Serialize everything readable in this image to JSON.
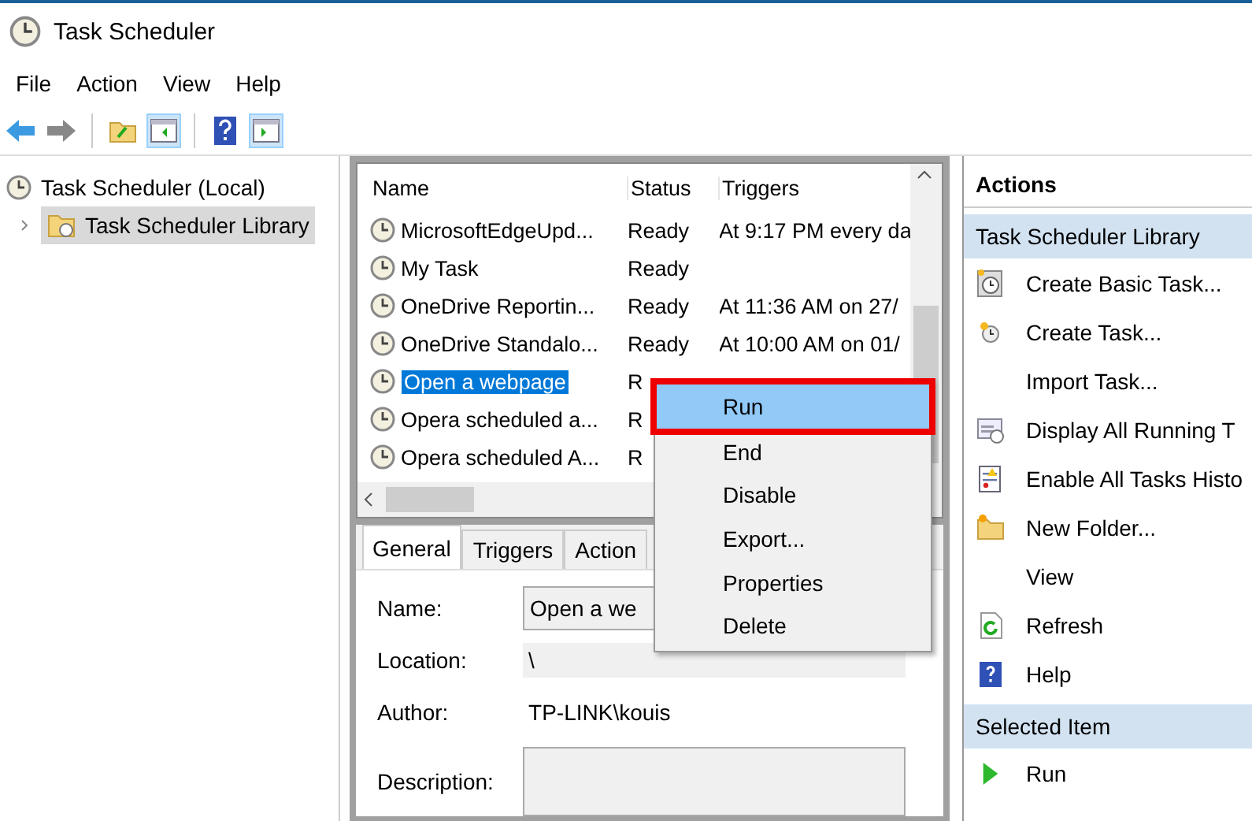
{
  "window": {
    "title": "Task Scheduler"
  },
  "menu": [
    "File",
    "Action",
    "View",
    "Help"
  ],
  "tree": [
    {
      "label": "Task Scheduler (Local)",
      "selected": false,
      "children": [
        {
          "label": "Task Scheduler Library",
          "expanded": false,
          "selected": true
        }
      ]
    }
  ],
  "task_list": {
    "columns": [
      "Name",
      "Status",
      "Triggers"
    ],
    "rows": [
      {
        "name": "MicrosoftEdgeUpd...",
        "status": "Ready",
        "triggers": "At 9:17 PM every da",
        "selected": false
      },
      {
        "name": "My Task",
        "status": "Ready",
        "triggers": "",
        "selected": false
      },
      {
        "name": "OneDrive Reportin...",
        "status": "Ready",
        "triggers": "At 11:36 AM on 27/",
        "selected": false
      },
      {
        "name": "OneDrive Standalo...",
        "status": "Ready",
        "triggers": "At 10:00 AM on 01/",
        "selected": false
      },
      {
        "name": "Open a webpage",
        "status": "R",
        "triggers": "",
        "selected": true
      },
      {
        "name": "Opera scheduled a...",
        "status": "R",
        "triggers": "",
        "selected": false
      },
      {
        "name": "Opera scheduled A...",
        "status": "R",
        "triggers": "",
        "selected": false
      }
    ]
  },
  "context_menu": [
    {
      "label": "Run",
      "selected": true
    },
    {
      "label": "End",
      "selected": false
    },
    {
      "label": "Disable",
      "selected": false
    },
    {
      "label": "Export...",
      "selected": false
    },
    {
      "label": "Properties",
      "selected": false
    },
    {
      "label": "Delete",
      "selected": false
    }
  ],
  "detail_tabs": [
    {
      "label": "General",
      "selected": true
    },
    {
      "label": "Triggers",
      "selected": false
    },
    {
      "label": "Action",
      "selected": false
    }
  ],
  "details": [
    {
      "kind": "field",
      "label": "Name:",
      "value": "Open a we"
    },
    {
      "kind": "readonly",
      "label": "Location:",
      "value": "\\"
    },
    {
      "kind": "text",
      "label": "Author:",
      "value": "TP-LINK\\kouis"
    },
    {
      "kind": "field",
      "label": "Description:"
    }
  ],
  "actions": {
    "title": "Actions",
    "groups": [
      {
        "title": "Task Scheduler Library",
        "items": [
          "Create Basic Task...",
          "Create Task...",
          "Import Task...",
          "Display All Running T",
          "Enable All Tasks Histo",
          "New Folder...",
          "View",
          "Refresh",
          "Help"
        ]
      },
      {
        "title": "Selected Item",
        "items": [
          "Run"
        ]
      }
    ]
  }
}
